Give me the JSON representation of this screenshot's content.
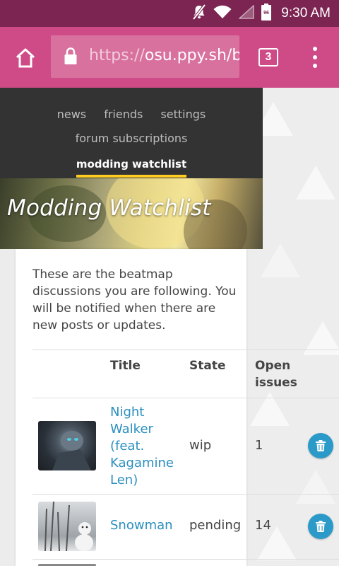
{
  "status_bar": {
    "time": "9:30 AM",
    "battery_level": "96",
    "icons": [
      "mute-icon",
      "wifi-icon",
      "signal-icon",
      "battery-icon"
    ]
  },
  "browser": {
    "url_prefix": "https://",
    "url_host": "osu.ppy.sh/b",
    "tab_count": "3"
  },
  "nav": {
    "row1": [
      "news",
      "friends",
      "settings"
    ],
    "row2": [
      "forum subscriptions"
    ],
    "active": "modding watchlist"
  },
  "header": {
    "title": "Modding Watchlist"
  },
  "intro": "These are the beatmap discussions you are following. You will be notified when there are new posts or updates.",
  "table": {
    "columns": [
      "",
      "Title",
      "State",
      "Open issues"
    ],
    "rows": [
      {
        "title": "Night Walker (feat. Kagamine Len)",
        "state": "wip",
        "open_issues": "1"
      },
      {
        "title": "Snowman",
        "state": "pending",
        "open_issues": "14"
      }
    ]
  },
  "colors": {
    "status_bar": "#7c2552",
    "toolbar": "#cf4b87",
    "nav_panel": "#333333",
    "active_underline": "#ffcc22",
    "link": "#2a8fbf",
    "delete_button": "#2c9ac8"
  }
}
